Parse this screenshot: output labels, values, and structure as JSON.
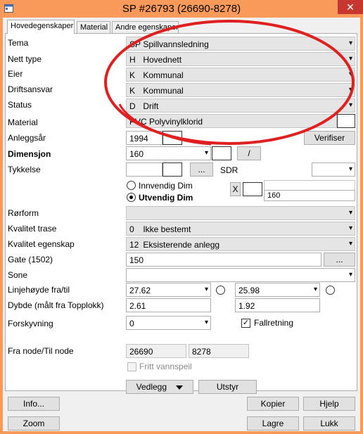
{
  "window": {
    "title": "SP #26793 (26690-8278)",
    "close_glyph": "✕",
    "app_icon": "app-icon",
    "title_bar_color": "#fa9a5a"
  },
  "tabs": [
    {
      "label": "Hovedegenskaper",
      "active": true
    },
    {
      "label": "Material"
    },
    {
      "label": "Andre egenskaper"
    }
  ],
  "labels": {
    "tema": "Tema",
    "nett_type": "Nett type",
    "eier": "Eier",
    "driftsansvar": "Driftsansvar",
    "status": "Status",
    "material": "Material",
    "anleggsar": "Anleggsår",
    "dimensjon": "Dimensjon",
    "tykkelse": "Tykkelse",
    "sdr": "SDR",
    "innvendig_dim": "Innvendig Dim",
    "utvendig_dim": "Utvendig Dim",
    "rorform": "Rørform",
    "kvalitet_trase": "Kvalitet trase",
    "kvalitet_egenskap": "Kvalitet egenskap",
    "gate": "Gate (1502)",
    "sone": "Sone",
    "linjehoyde": "Linjehøyde fra/til",
    "dybde": "Dybde (målt fra Topplokk)",
    "forskyvning": "Forskyvning",
    "fra_til_node": "Fra node/Til node",
    "fallretning": "Fallretning",
    "fritt_vannspeil": "Fritt vannspeil"
  },
  "values": {
    "tema": {
      "code": "SP",
      "text": "Spillvannsledning"
    },
    "nett_type": {
      "code": "H",
      "text": "Hovednett"
    },
    "eier": {
      "code": "K",
      "text": "Kommunal"
    },
    "driftsansvar": {
      "code": "K",
      "text": "Kommunal"
    },
    "status": {
      "code": "D",
      "text": "Drift"
    },
    "material": "PVC Polyvinylklorid",
    "anleggsar": "1994",
    "dimensjon": "160",
    "x_label": "X",
    "utvendig_value": "160",
    "kvalitet_trase": {
      "code": "0",
      "text": "Ikke bestemt"
    },
    "kvalitet_egenskap": {
      "code": "12",
      "text": "Eksisterende anlegg"
    },
    "gate": "150",
    "linjehoyde_fra": "27.62",
    "linjehoyde_til": "25.98",
    "dybde_fra": "2.61",
    "dybde_til": "1.92",
    "forskyvning": "0",
    "fra_node": "26690",
    "til_node": "8278",
    "fallretning_checked": true,
    "fritt_vannspeil_checked": false
  },
  "buttons": {
    "verifiser": "Verifiser",
    "slash": "/",
    "ellipsis": "...",
    "vedlegg": "Vedlegg",
    "utstyr": "Utstyr",
    "info": "Info...",
    "kopier": "Kopier",
    "hjelp": "Hjelp",
    "zoom": "Zoom",
    "lagre": "Lagre",
    "lukk": "Lukk"
  },
  "icons": {
    "dropdown": "▾",
    "check": "✓"
  },
  "annotation": {
    "type": "red-ellipse",
    "color": "#e02020"
  }
}
